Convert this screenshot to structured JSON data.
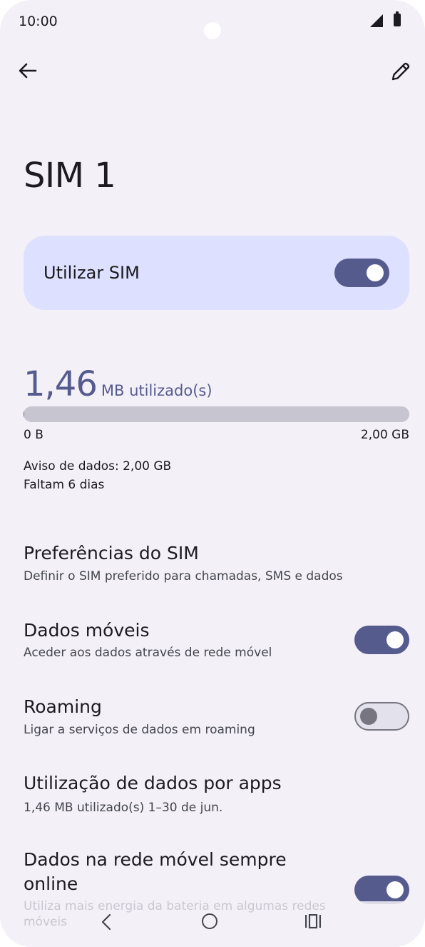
{
  "status_bar": {
    "time": "10:00"
  },
  "header": {
    "title": "SIM 1"
  },
  "use_sim": {
    "label": "Utilizar SIM",
    "enabled": true
  },
  "usage": {
    "amount": "1,46",
    "unit": "MB utilizado(s)",
    "fraction_used": 0.0007,
    "range_min": "0 B",
    "range_max": "2,00 GB",
    "warning": "Aviso de dados: 2,00 GB",
    "days_left": "Faltam 6 dias"
  },
  "settings": [
    {
      "title": "Preferências do SIM",
      "subtitle": "Definir o SIM preferido para chamadas, SMS e dados"
    },
    {
      "title": "Dados móveis",
      "subtitle": "Aceder aos dados através de rede móvel",
      "toggle": true
    },
    {
      "title": "Roaming",
      "subtitle": "Ligar a serviços de dados em roaming",
      "toggle": false
    },
    {
      "title": "Utilização de dados por apps",
      "subtitle": "1,46 MB utilizado(s) 1–30 de jun."
    },
    {
      "title_line1": "Dados na rede móvel sempre",
      "title_line2": "online",
      "subtitle": "Utiliza mais energia da bateria em algumas redes móveis",
      "toggle": true
    }
  ],
  "colors": {
    "accent": "#565b8e",
    "card": "#dee0ff",
    "background": "#f3f0f7"
  }
}
